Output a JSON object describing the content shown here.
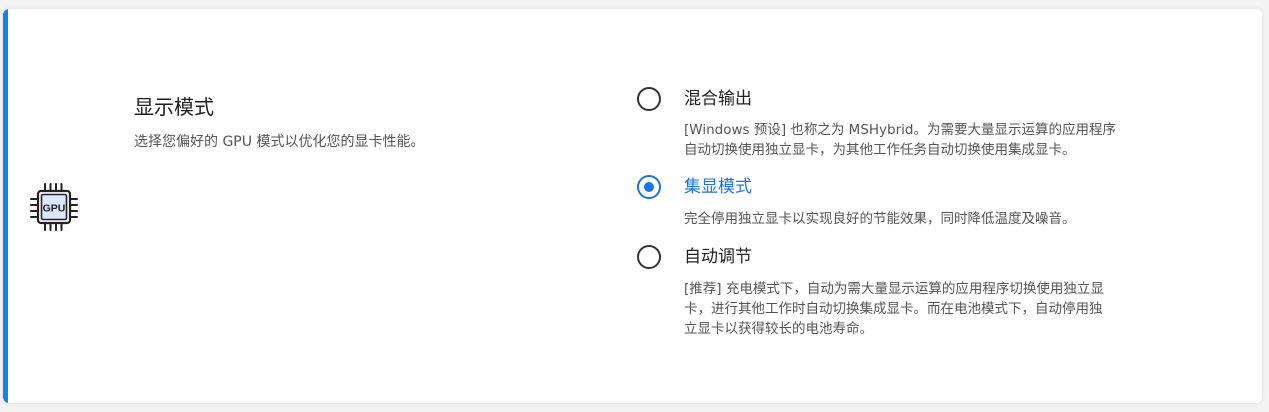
{
  "setting": {
    "icon": "gpu-chip-icon",
    "icon_text": "GPU",
    "title": "显示模式",
    "subtitle": "选择您偏好的 GPU 模式以优化您的显卡性能。"
  },
  "options": [
    {
      "label": "混合输出",
      "selected": false,
      "desc_lines": [
        "[Windows 预设] 也称之为 MSHybrid。为需要大量显示运算的应用程序",
        "自动切换使用独立显卡，为其他工作任务自动切换使用集成显卡。"
      ]
    },
    {
      "label": "集显模式",
      "selected": true,
      "desc_lines": [
        "完全停用独立显卡以实现良好的节能效果，同时降低温度及噪音。"
      ]
    },
    {
      "label": "自动调节",
      "selected": false,
      "desc_lines": [
        "[推荐] 充电模式下，自动为需大量显示运算的应用程序切换使用独立显",
        "卡，进行其他工作时自动切换集成显卡。而在电池模式下，自动停用独",
        "立显卡以获得较长的电池寿命。"
      ]
    }
  ],
  "colors": {
    "accent": "#1a7fe6",
    "selected": "#1a73e8"
  }
}
